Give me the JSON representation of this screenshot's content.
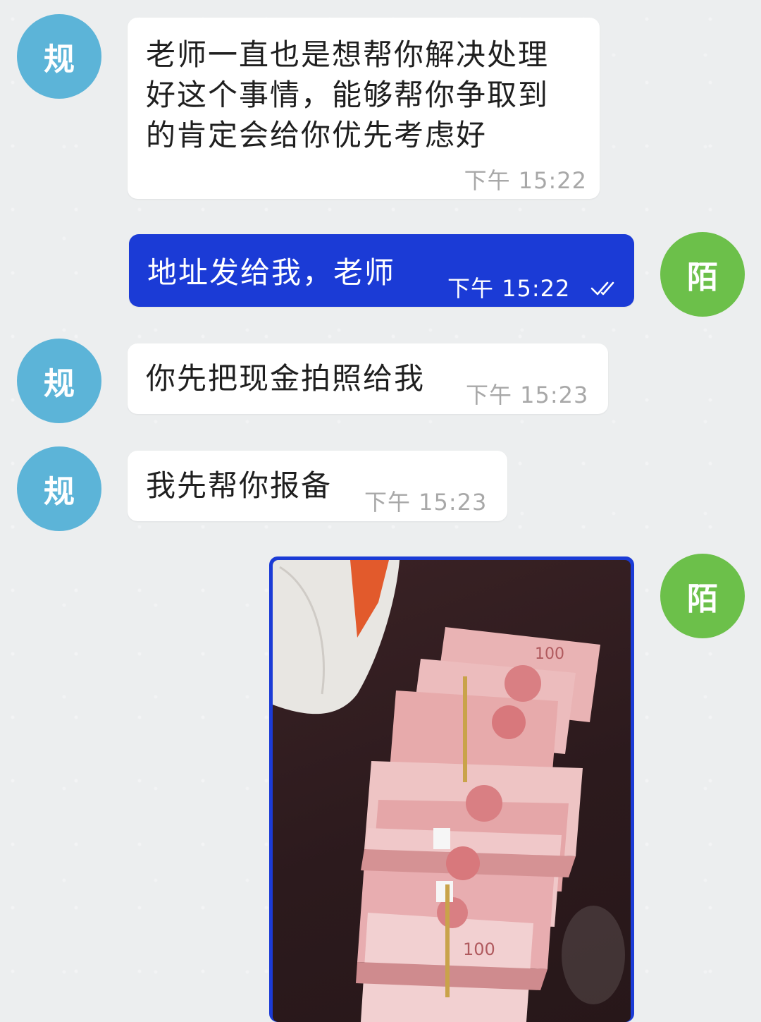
{
  "messages": [
    {
      "sender_avatar": "规",
      "text_lines": [
        "老师一直也是想帮你解决处理",
        "好这个事情，能够帮你争取到",
        "的肯定会给你优先考虑好"
      ],
      "time": "下午  15:22"
    },
    {
      "sender_avatar": "陌",
      "text": "地址发给我，老师",
      "time": "下午  15:22",
      "status_icon": "double-check-icon"
    },
    {
      "sender_avatar": "规",
      "text": "你先把现金拍照给我",
      "time": "下午  15:23"
    },
    {
      "sender_avatar": "规",
      "text": "我先帮你报备",
      "time": "下午  15:23"
    },
    {
      "sender_avatar": "陌",
      "image": "photo-cash-stacks"
    }
  ],
  "colors": {
    "background": "#eceeef",
    "incoming_bubble": "#ffffff",
    "outgoing_bubble": "#1b3bd6",
    "avatar_left": "#5cb4d8",
    "avatar_right": "#6cc04a"
  }
}
